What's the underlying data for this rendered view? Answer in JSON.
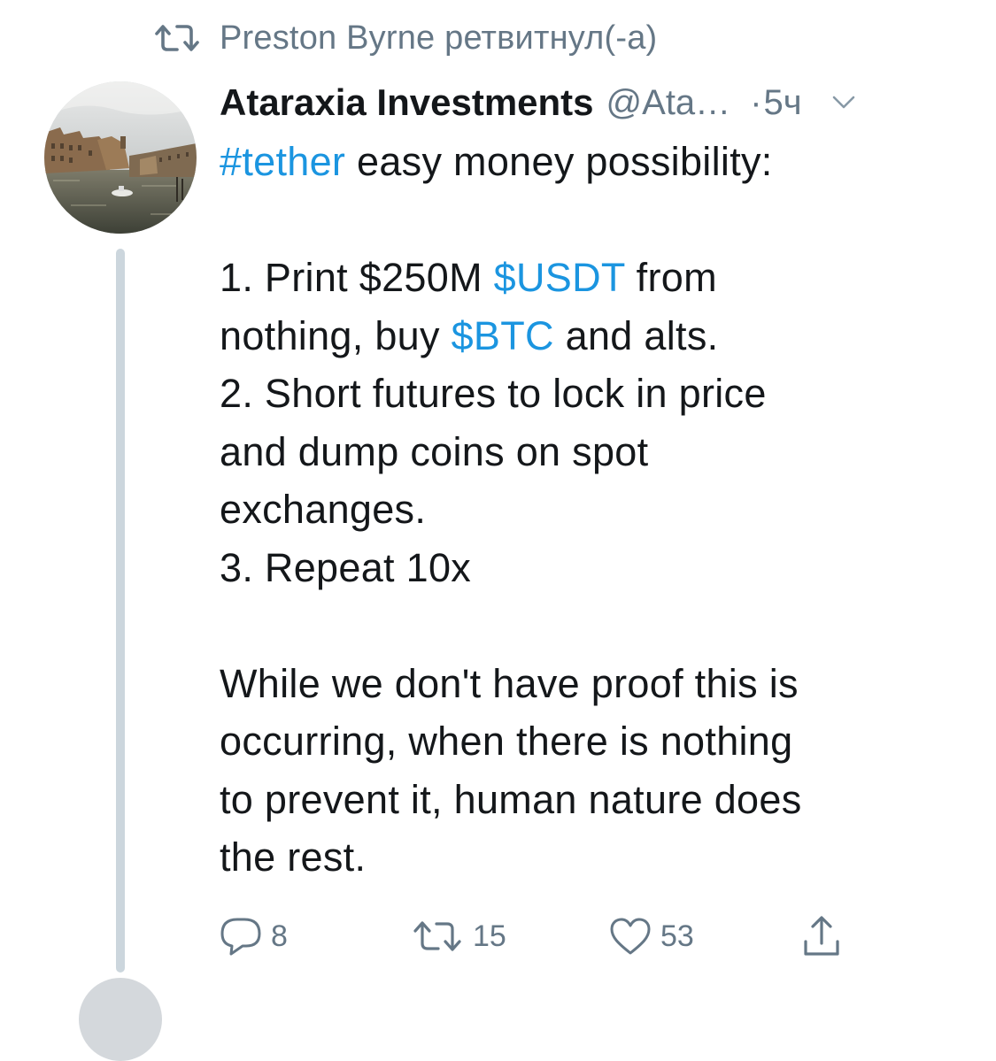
{
  "retweet_context": {
    "text": "Preston Byrne ретвитнул(-а)",
    "icon": "retweet-icon"
  },
  "tweet": {
    "display_name": "Ataraxia Investments",
    "handle": "@Ata…",
    "separator": "·",
    "timestamp": "5ч",
    "body": {
      "line1": {
        "link": "#tether",
        "text": " easy money possibility:"
      },
      "line2": {
        "pre": "1. Print $250M ",
        "link": "$USDT",
        "post": " from"
      },
      "line3": {
        "pre": "nothing, buy ",
        "link": "$BTC",
        "post": " and alts."
      },
      "line4": "2. Short futures to lock in price",
      "line5": "and dump coins on spot",
      "line6": "exchanges.",
      "line7": "3. Repeat 10x",
      "line8": "While we don't have proof this is",
      "line9": "occurring, when there is nothing",
      "line10": "to prevent it, human nature does",
      "line11": "the rest."
    }
  },
  "actions": {
    "reply": {
      "icon": "reply-icon",
      "count": "8"
    },
    "retweet": {
      "icon": "retweet-icon",
      "count": "15"
    },
    "like": {
      "icon": "heart-icon",
      "count": "53"
    },
    "share": {
      "icon": "share-icon"
    }
  },
  "colors": {
    "link": "#1b95e0",
    "text": "#14171a",
    "secondary": "#657786",
    "thread_line": "#ccd6dd"
  }
}
